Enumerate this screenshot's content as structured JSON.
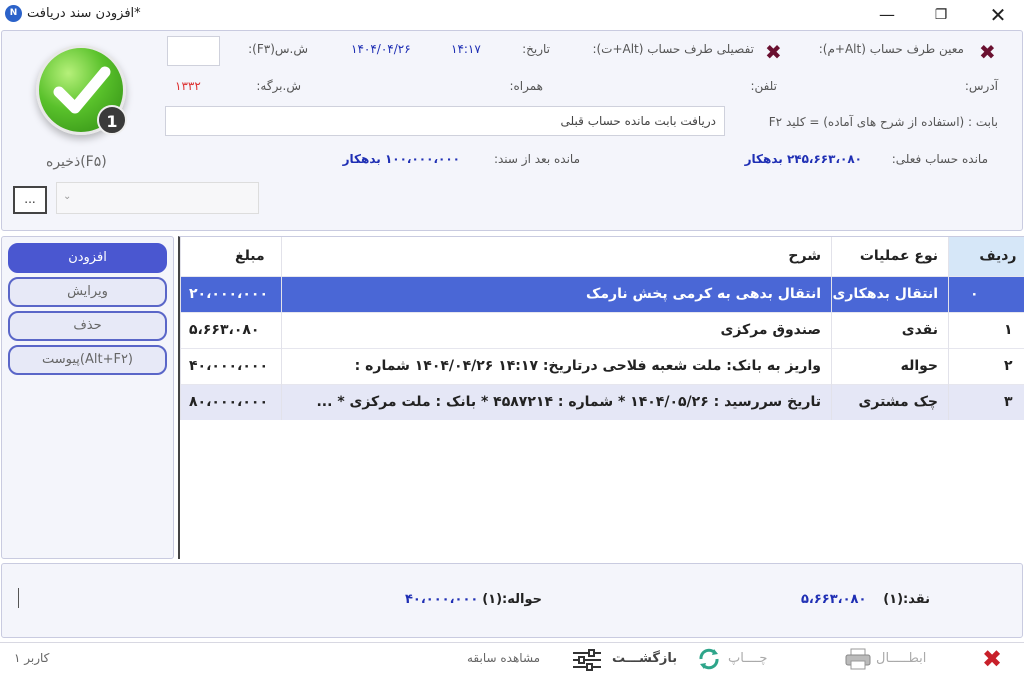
{
  "window": {
    "title": "افزودن سند دریافت*",
    "app_icon_text": "N"
  },
  "header": {
    "counterparty_label": "معین طرف حساب (Alt+م):",
    "detail_label": "تفصیلی طرف حساب (Alt+ت):",
    "date_label": "تاریخ:",
    "date_value": "۱۴۰۴/۰۴/۲۶",
    "time_value": "۱۴:۱۷",
    "doc_no_label": "ش.س(F۳):",
    "doc_no_value": "",
    "address_label": "آدرس:",
    "phone_label": "تلفن:",
    "mobile_label": "همراه:",
    "sheet_no_label": "ش.برگه:",
    "sheet_no_value": "۱۳۳۲",
    "description_label": "بابت : (استفاده از شرح های آماده) = کلید F۲",
    "description_value": "دریافت بابت مانده حساب قبلی",
    "current_balance_label": "مانده حساب فعلی:",
    "current_balance_value": "۲۴۵،۶۶۳،۰۸۰ بدهکار",
    "after_balance_label": "مانده بعد از سند:",
    "after_balance_value": "۱۰۰،۰۰۰،۰۰۰ بدهکار",
    "save_label": "ذخیره(F۵)",
    "badge": "1",
    "more_button": "...",
    "dropdown_value": ""
  },
  "side_buttons": {
    "add": "افزودن",
    "edit": "ویرایش",
    "delete": "حذف",
    "attach": "پیوست(Alt+F۲)"
  },
  "table": {
    "headers": [
      "ردیف",
      "نوع عملیات",
      "شرح",
      "مبلغ"
    ],
    "rows": [
      [
        "۰",
        "انتقال بدهکاری",
        "انتقال بدهی به کرمی پخش نارمک",
        "۲۰،۰۰۰،۰۰۰"
      ],
      [
        "۱",
        "نقدی",
        "صندوق مرکزی",
        "۵،۶۶۳،۰۸۰"
      ],
      [
        "۲",
        "حواله",
        "واریز به بانک: ملت شعبه فلاحی درتاریخ: ۱۴:۱۷ ۱۴۰۴/۰۴/۲۶ شماره :",
        "۴۰،۰۰۰،۰۰۰"
      ],
      [
        "۳",
        "چک مشتری",
        "تاریخ سررسید : ۱۴۰۴/۰۵/۲۶ * شماره : ۴۵۸۷۲۱۴ * بانک : ملت مرکزی *  ...",
        "۸۰،۰۰۰،۰۰۰"
      ]
    ]
  },
  "summary": {
    "cash_label": "نقد:(۱)",
    "cash_value": "۵،۶۶۳،۰۸۰",
    "transfer_label": "حواله:(۱)",
    "transfer_value": "۴۰،۰۰۰،۰۰۰"
  },
  "footer": {
    "cancel": "ابطـــــال",
    "print": "چــــاپ",
    "back": "بازگشـــت",
    "history": "مشاهده سابقه",
    "user": "کاربر ۱"
  },
  "colors": {
    "accent": "#4a57d0",
    "selected_row": "#4a67d6",
    "value_blue": "#1f2fb4",
    "value_red": "#dd3333"
  }
}
